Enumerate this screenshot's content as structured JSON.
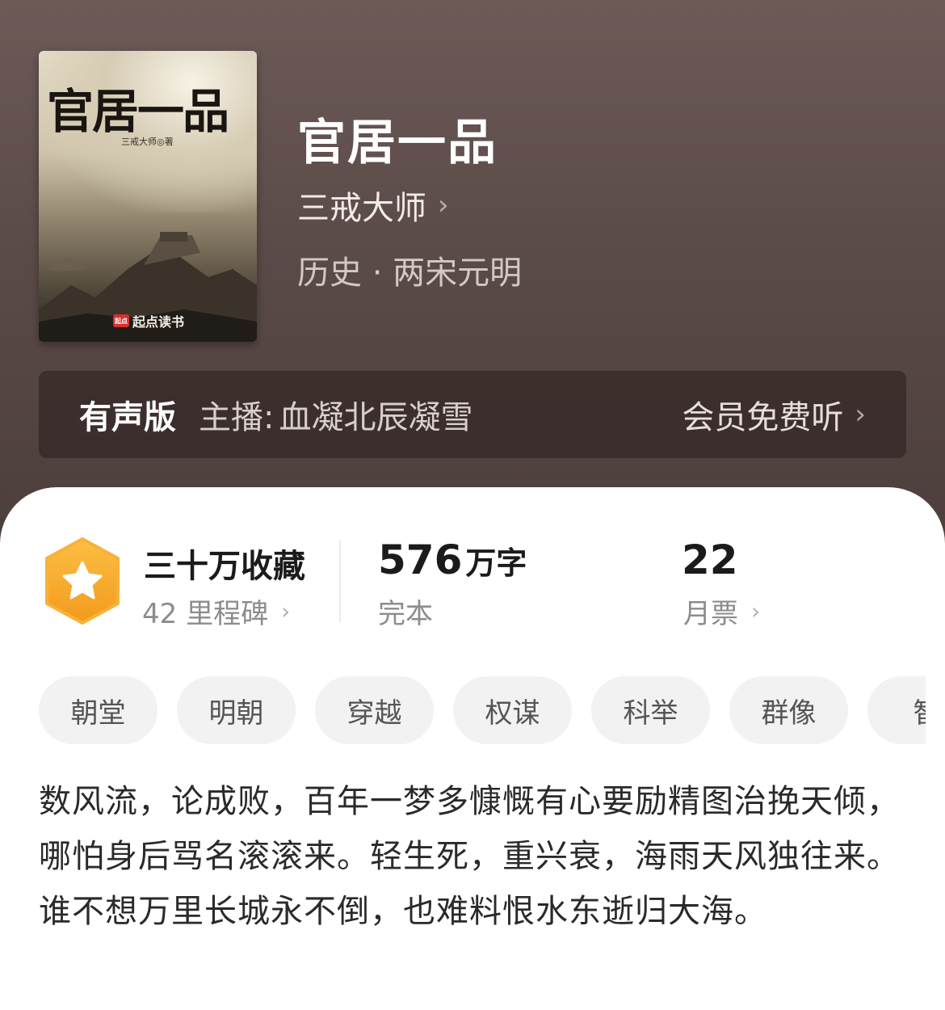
{
  "book": {
    "title": "官居一品",
    "author": "三戒大师",
    "genre": "历史 · 两宋元明",
    "cover": {
      "title": "官居一品",
      "author": "三戒大师◎著",
      "brand": "起点读书",
      "brand_logo": "起点"
    }
  },
  "audio": {
    "label": "有声版",
    "host_prefix": "主播:",
    "host": "血凝北辰凝雪",
    "free_text": "会员免费听"
  },
  "stats": {
    "collect_title": "三十万收藏",
    "milestone": "42 里程碑",
    "words_num": "576",
    "words_unit": "万字",
    "status": "完本",
    "tickets_num": "22",
    "tickets_label": "月票"
  },
  "tags": [
    "朝堂",
    "明朝",
    "穿越",
    "权谋",
    "科举",
    "群像",
    "智"
  ],
  "description": "数风流，论成败，百年一梦多慷慨有心要励精图治挽天倾，哪怕身后骂名滚滚来。轻生死，重兴衰，海雨天风独往来。谁不想万里长城永不倒，也难料恨水东逝归大海。",
  "colors": {
    "header_bg": "#5b4b48",
    "badge_orange": "#f5a623"
  }
}
